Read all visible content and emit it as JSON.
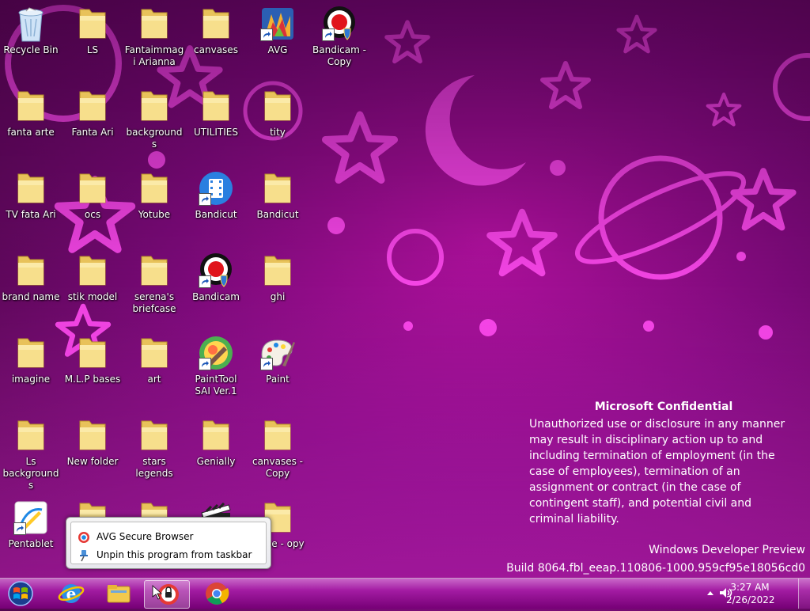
{
  "desktop": {
    "icons": [
      {
        "label": "Recycle Bin",
        "type": "recycle"
      },
      {
        "label": "LS",
        "type": "folder"
      },
      {
        "label": "Fantaimmagi Arianna",
        "type": "folder"
      },
      {
        "label": "canvases",
        "type": "folder"
      },
      {
        "label": "AVG",
        "type": "avg"
      },
      {
        "label": "Bandicam - Copy",
        "type": "bandicam"
      },
      {
        "label": "fanta arte",
        "type": "folder"
      },
      {
        "label": "Fanta Ari",
        "type": "folder"
      },
      {
        "label": "backgrounds",
        "type": "folder"
      },
      {
        "label": "UTILITIES",
        "type": "folder"
      },
      {
        "label": "tity",
        "type": "folder"
      },
      {
        "label": "TV  fata Ari",
        "type": "folder"
      },
      {
        "label": "ocs",
        "type": "folder"
      },
      {
        "label": "Yotube",
        "type": "folder"
      },
      {
        "label": "Bandicut",
        "type": "bandicut"
      },
      {
        "label": "Bandicut",
        "type": "folder"
      },
      {
        "label": "brand name",
        "type": "folder"
      },
      {
        "label": "stik  model",
        "type": "folder"
      },
      {
        "label": "serena's briefcase",
        "type": "folder"
      },
      {
        "label": "Bandicam",
        "type": "bandicam"
      },
      {
        "label": "ghi",
        "type": "folder"
      },
      {
        "label": "imagine",
        "type": "folder"
      },
      {
        "label": "M.L.P bases",
        "type": "folder"
      },
      {
        "label": "art",
        "type": "folder"
      },
      {
        "label": "PaintTool SAI Ver.1",
        "type": "sai"
      },
      {
        "label": "Paint",
        "type": "paint"
      },
      {
        "label": "Ls backgrounds",
        "type": "folder"
      },
      {
        "label": "New folder",
        "type": "folder"
      },
      {
        "label": "stars legends",
        "type": "folder"
      },
      {
        "label": "Genially",
        "type": "folder"
      },
      {
        "label": "canvases - Copy",
        "type": "folder"
      },
      {
        "label": "Pentablet",
        "type": "pentablet"
      },
      {
        "label": "",
        "type": "folder"
      },
      {
        "label": "",
        "type": "folder"
      },
      {
        "label": "",
        "type": "clapper"
      },
      {
        "label": "agine - opy",
        "type": "folder"
      }
    ]
  },
  "watermark": {
    "title": "Microsoft Confidential",
    "body": "Unauthorized use or disclosure in any manner may result in disciplinary action up to and including termination of employment (in the case of employees), termination of an assignment or contract (in the case of contingent staff), and potential civil and criminal liability.",
    "product": "Windows Developer Preview",
    "build": "Build 8064.fbl_eeap.110806-1000.959cf95e18056cd0"
  },
  "jumplist": {
    "items": [
      {
        "label": "AVG Secure Browser",
        "icon": "avg-browser-icon"
      },
      {
        "label": "Unpin this program from taskbar",
        "icon": "unpin-icon"
      }
    ]
  },
  "taskbar": {
    "buttons": [
      "start-orb",
      "internet-explorer",
      "file-explorer",
      "avg-secure-browser",
      "chrome"
    ],
    "clock": {
      "time": "3:27 AM",
      "date": "2/26/2022"
    }
  },
  "colors": {
    "accent": "#b0119e",
    "taskbar": "#a020a0"
  }
}
